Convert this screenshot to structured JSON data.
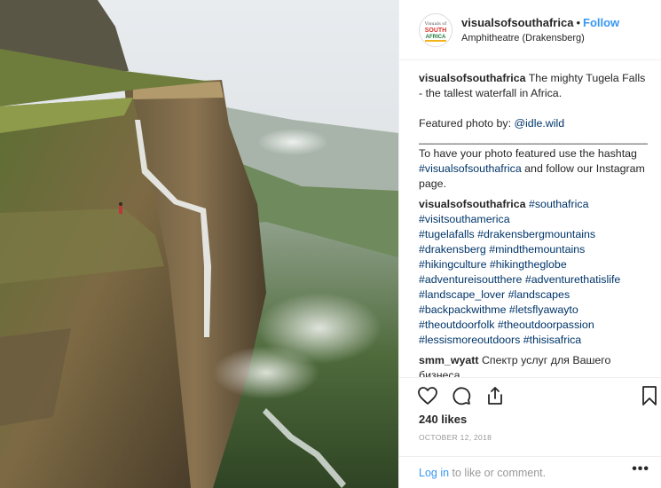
{
  "post": {
    "username": "visualsofsouthafrica",
    "dot": "•",
    "follow": "Follow",
    "location": "Amphitheatre (Drakensberg)",
    "avatar_text": [
      "Visuals of",
      "SOUTH",
      "AFRICA"
    ]
  },
  "caption": {
    "username": "visualsofsouthafrica",
    "text": "The mighty Tugela Falls - the tallest waterfall in Africa.",
    "featured_prefix": "Featured photo by: ",
    "featured_handle": "@idle.wild",
    "separator": "_______________________________________",
    "cta_prefix": "To have your photo featured use the hashtag ",
    "cta_tag": "#visualsofsouthafrica",
    "cta_suffix": " and follow our Instagram page."
  },
  "hashtag_comment": {
    "username": "visualsofsouthafrica",
    "lines": [
      "#southafrica",
      "#visitsouthamerica",
      "#tugelafalls #drakensbergmountains",
      "#drakensberg #mindthemountains",
      "#hikingculture #hikingtheglobe",
      "#adventureisoutthere #adventurethatislife",
      "#landscape_lover #landscapes",
      "#backpackwithme #letsflyawayto",
      "#theoutdoorfolk #theoutdoorpassion",
      "#lessismoreoutdoors #thisisafrica"
    ]
  },
  "other_comment": {
    "username": "smm_wyatt",
    "text": "Спектр услуг для Вашего бизнеса"
  },
  "actions": {
    "icons": [
      "heart-icon",
      "comment-icon",
      "share-icon",
      "bookmark-icon"
    ],
    "likes": "240 likes",
    "date": "OCTOBER 12, 2018",
    "login_link": "Log in",
    "login_suffix": " to like or comment.",
    "more": "•••"
  },
  "colors": {
    "link": "#003569",
    "follow": "#3897f0",
    "muted": "#999999"
  }
}
